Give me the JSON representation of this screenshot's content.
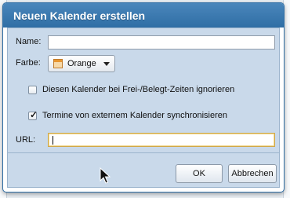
{
  "dialog": {
    "title": "Neuen Kalender erstellen"
  },
  "form": {
    "name_label": "Name:",
    "name_value": "",
    "color_label": "Farbe:",
    "color_value": "Orange",
    "ignore_busy_label": "Diesen Kalender bei Frei-/Belegt-Zeiten ignorieren",
    "ignore_busy_checked": false,
    "sync_label": "Termine von externem Kalender synchronisieren",
    "sync_checked": true,
    "url_label": "URL:",
    "url_value": ""
  },
  "buttons": {
    "ok": "OK",
    "cancel": "Abbrechen"
  },
  "colors": {
    "titlebar": "#2f6ea5",
    "body": "#c9d9ea",
    "swatch_orange": "#e8962f"
  },
  "icons": {
    "color_swatch": "calendar-color-swatch-icon",
    "dropdown": "chevron-down-icon",
    "pointer": "mouse-pointer-icon"
  }
}
